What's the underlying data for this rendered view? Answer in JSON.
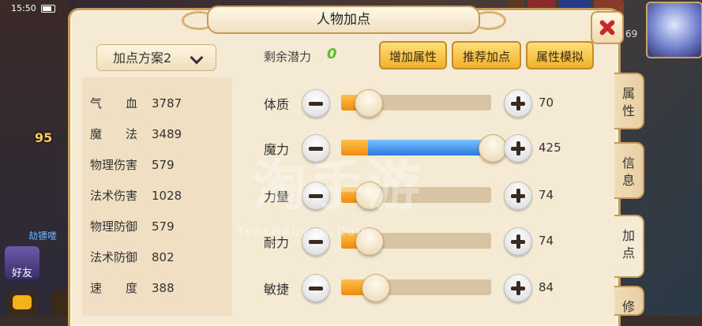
{
  "status_bar": {
    "time": "15:50"
  },
  "hud": {
    "level_badge": "95",
    "side_text": "劫镖喽",
    "friend_label": "好友",
    "avatar_level": "69"
  },
  "panel": {
    "title": "人物加点",
    "scheme_select": "加点方案2",
    "remaining_label": "剩余潜力",
    "remaining_value": "0",
    "buttons": {
      "add_attr": "增加属性",
      "recommend": "推荐加点",
      "simulate": "属性模拟"
    },
    "stats": [
      {
        "label": "气　　血",
        "value": "3787"
      },
      {
        "label": "魔　　法",
        "value": "3489"
      },
      {
        "label": "物理伤害",
        "value": "579"
      },
      {
        "label": "法术伤害",
        "value": "1028"
      },
      {
        "label": "物理防御",
        "value": "579"
      },
      {
        "label": "法术防御",
        "value": "802"
      },
      {
        "label": "速　　度",
        "value": "388"
      }
    ],
    "attributes": [
      {
        "label": "体质",
        "value": "70",
        "fill_base": 0.15,
        "fill_extra": 0.0
      },
      {
        "label": "魔力",
        "value": "425",
        "fill_base": 0.18,
        "fill_extra": 0.8
      },
      {
        "label": "力量",
        "value": "74",
        "fill_base": 0.16,
        "fill_extra": 0.0
      },
      {
        "label": "耐力",
        "value": "74",
        "fill_base": 0.16,
        "fill_extra": 0.0
      },
      {
        "label": "敏捷",
        "value": "84",
        "fill_base": 0.2,
        "fill_extra": 0.0
      }
    ],
    "tabs": [
      {
        "label": "属性",
        "chars": [
          "属",
          "性"
        ],
        "active": false
      },
      {
        "label": "信息",
        "chars": [
          "信",
          "息"
        ],
        "active": false
      },
      {
        "label": "加点",
        "chars": [
          "加",
          "点"
        ],
        "active": true
      },
      {
        "label": "修",
        "chars": [
          "修"
        ],
        "active": false
      }
    ]
  },
  "watermark": {
    "main": "淘手游",
    "sub": "Taoshouyou.Com"
  },
  "icons": [
    "close-icon",
    "chevron-down-icon",
    "minus-icon",
    "plus-icon",
    "chat-icon",
    "friend-icon"
  ],
  "colors": {
    "accent_gold": "#f0b02a",
    "fill_orange": "#f08a10",
    "fill_blue": "#2a7ae0",
    "remaining_green": "#5bbf2a",
    "close_red": "#c8282a"
  }
}
